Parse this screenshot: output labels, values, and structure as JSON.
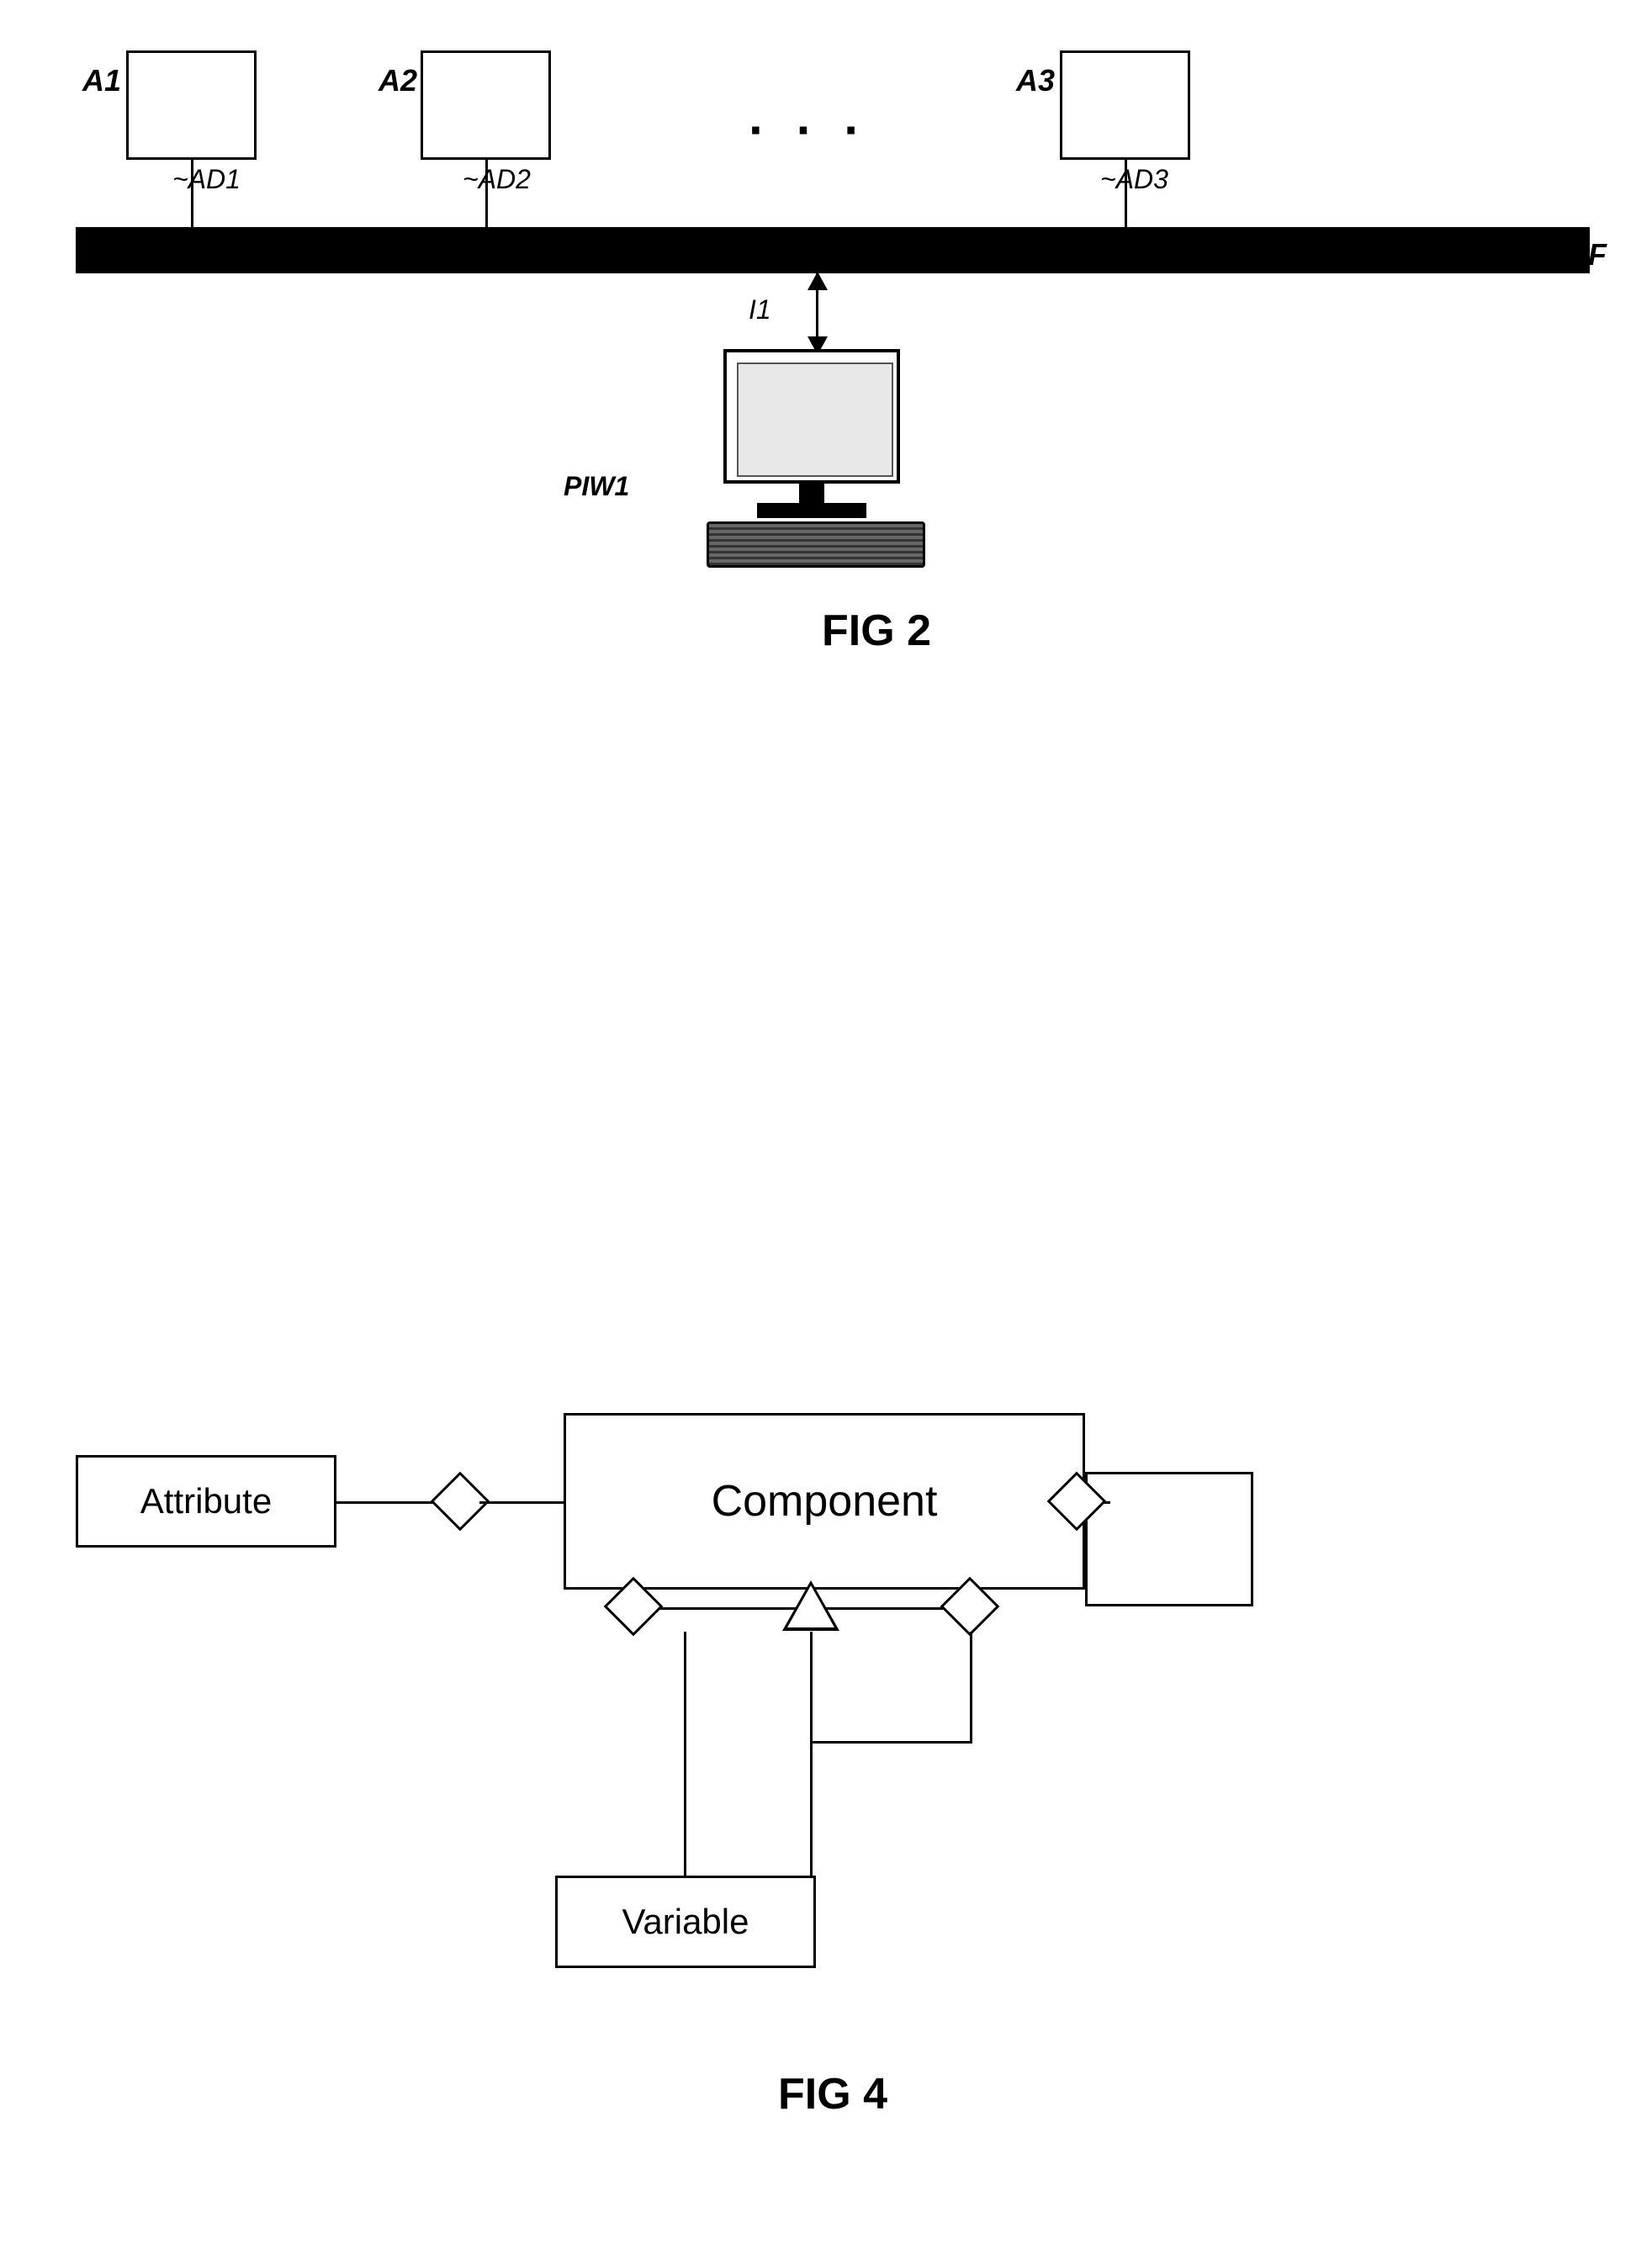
{
  "fig2": {
    "title": "FIG 2",
    "agents": [
      {
        "id": "A1",
        "adapter": "AD1"
      },
      {
        "id": "A2",
        "adapter": "AD2"
      },
      {
        "id": "A3",
        "adapter": "AD3"
      }
    ],
    "bus": "IF",
    "connector": "I1",
    "workstation": "PIW1",
    "dots": "· · ·"
  },
  "fig4": {
    "title": "FIG 4",
    "attribute_label": "Attribute",
    "component_label": "Component",
    "variable_label": "Variable"
  }
}
